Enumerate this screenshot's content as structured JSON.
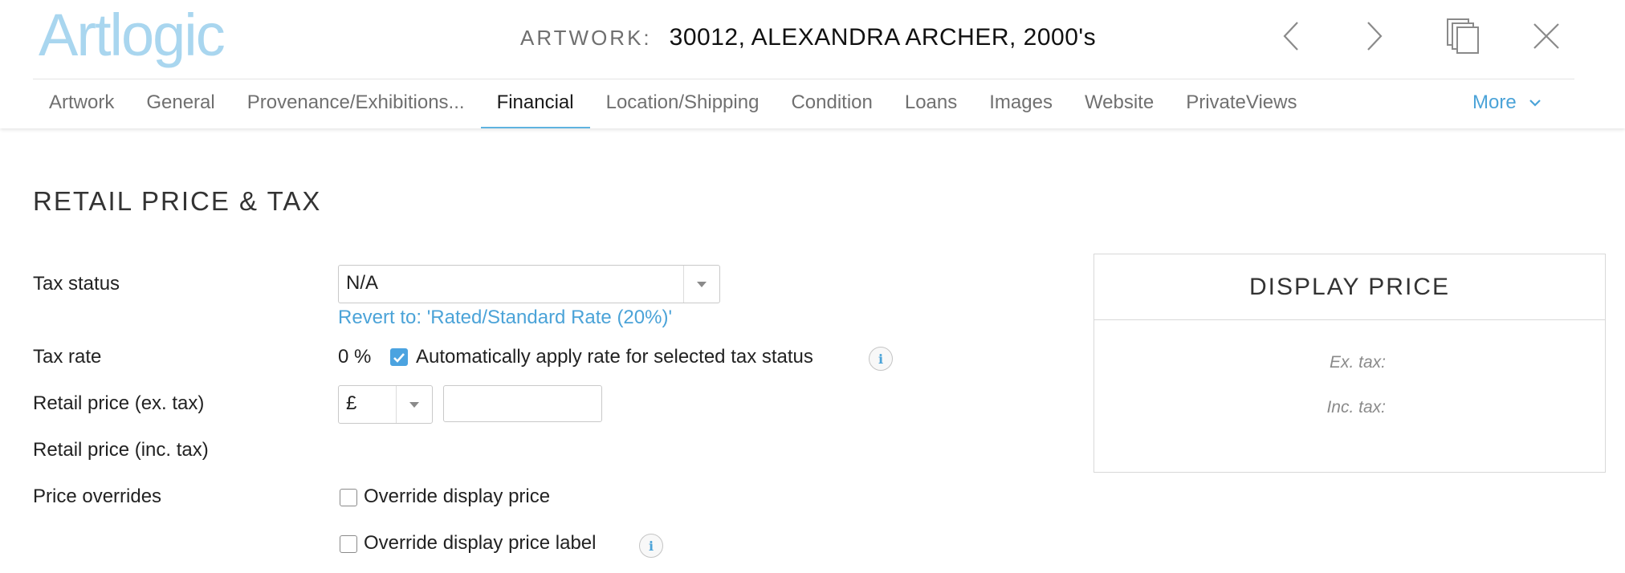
{
  "app": {
    "logo": "Artlogic"
  },
  "header": {
    "label": "ARTWORK:",
    "record": "30012, ALEXANDRA ARCHER, 2000's",
    "icons": {
      "prev": "chevron-left-icon",
      "next": "chevron-right-icon",
      "copy": "duplicate-icon",
      "close": "close-icon"
    }
  },
  "tabs": [
    {
      "label": "Artwork"
    },
    {
      "label": "General"
    },
    {
      "label": "Provenance/Exhibitions..."
    },
    {
      "label": "Financial",
      "active": true
    },
    {
      "label": "Location/Shipping"
    },
    {
      "label": "Condition"
    },
    {
      "label": "Loans"
    },
    {
      "label": "Images"
    },
    {
      "label": "Website"
    },
    {
      "label": "PrivateViews"
    }
  ],
  "more_label": "More",
  "section": {
    "title": "RETAIL PRICE & TAX"
  },
  "form": {
    "tax_status": {
      "label": "Tax status",
      "value": "N/A",
      "revert": "Revert to: 'Rated/Standard Rate (20%)'"
    },
    "tax_rate": {
      "label": "Tax rate",
      "value": "0 %",
      "auto_apply_label": "Automatically apply rate for selected tax status",
      "auto_apply_checked": true
    },
    "retail_ex": {
      "label": "Retail price (ex. tax)",
      "currency": "£",
      "value": ""
    },
    "retail_inc": {
      "label": "Retail price (inc. tax)"
    },
    "overrides": {
      "label": "Price overrides",
      "override_price_label": "Override display price",
      "override_price_checked": false,
      "override_label_label": "Override display price label",
      "override_label_checked": false
    }
  },
  "display_price": {
    "title": "DISPLAY PRICE",
    "ex_tax": "Ex. tax:",
    "inc_tax": "Inc. tax:"
  },
  "colors": {
    "accent": "#4ba3d8",
    "logo": "#a9d6ef",
    "checkbox": "#4ba3e0"
  }
}
